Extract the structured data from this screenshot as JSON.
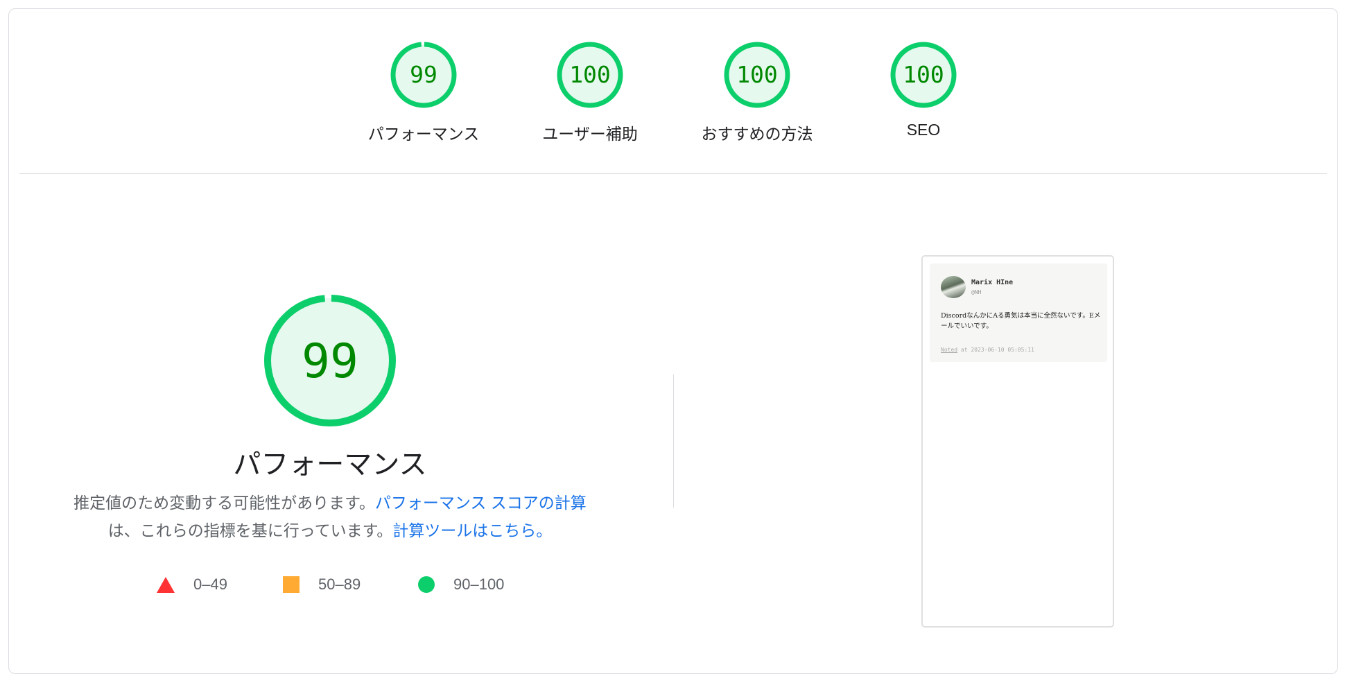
{
  "categories": [
    {
      "score": "99",
      "label": "パフォーマンス",
      "fraction": 0.99
    },
    {
      "score": "100",
      "label": "ユーザー補助",
      "fraction": 1.0
    },
    {
      "score": "100",
      "label": "おすすめの方法",
      "fraction": 1.0
    },
    {
      "score": "100",
      "label": "SEO",
      "fraction": 1.0
    }
  ],
  "performance": {
    "score": "99",
    "fraction": 0.99,
    "title": "パフォーマンス",
    "desc_part1": "推定値のため変動する可能性があります。",
    "link_score_calc": "パフォーマンス スコアの計算",
    "desc_part2": "は、これらの指標を基に行っています。",
    "link_calculator": "計算ツールはこちら。"
  },
  "legend": [
    {
      "shape": "triangle",
      "range": "0–49",
      "color": "#ff3333"
    },
    {
      "shape": "square",
      "range": "50–89",
      "color": "#ffaa33"
    },
    {
      "shape": "circle",
      "range": "90–100",
      "color": "#0cce6b"
    }
  ],
  "screenshot": {
    "name": "Marix HIne",
    "handle": "@NH",
    "body": "DiscordなんかにAる勇気は本当に全然ないです。Eメールでいいです。",
    "noted": "Noted",
    "meta": " at 2023-06-10 05:05:11"
  },
  "colors": {
    "pass": "#0cce6b",
    "pass_text": "#008800",
    "pass_bg": "#e5f9ee",
    "link": "#1a73e8"
  }
}
